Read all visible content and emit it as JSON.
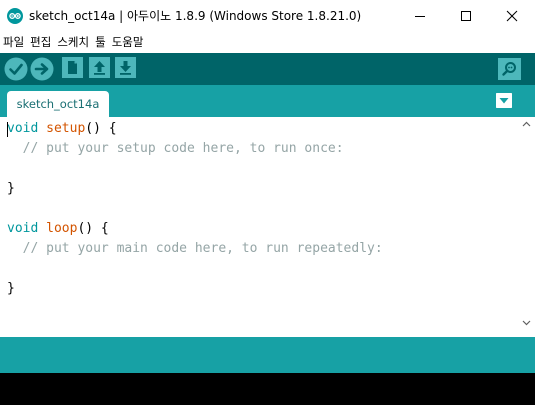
{
  "window": {
    "title": "sketch_oct14a | 아두이노 1.8.9 (Windows Store 1.8.21.0)"
  },
  "menu": {
    "items": [
      "파일",
      "편집",
      "스케치",
      "툴",
      "도움말"
    ]
  },
  "toolbar": {
    "buttons": [
      {
        "name": "verify",
        "icon": "check-icon"
      },
      {
        "name": "upload",
        "icon": "arrow-right-icon"
      },
      {
        "name": "new",
        "icon": "new-file-icon"
      },
      {
        "name": "open",
        "icon": "arrow-up-icon"
      },
      {
        "name": "save",
        "icon": "arrow-down-icon"
      },
      {
        "name": "serial-monitor",
        "icon": "magnifier-icon"
      }
    ]
  },
  "tabs": {
    "active": "sketch_oct14a"
  },
  "editor": {
    "lines": [
      {
        "kw": "void",
        "fn": "setup",
        "rest": "() {"
      },
      {
        "comment": "  // put your setup code here, to run once:"
      },
      {
        "plain": ""
      },
      {
        "plain": "}"
      },
      {
        "plain": ""
      },
      {
        "kw": "void",
        "fn": "loop",
        "rest": "() {"
      },
      {
        "comment": "  // put your main code here, to run repeatedly:"
      },
      {
        "plain": ""
      },
      {
        "plain": "}"
      }
    ]
  },
  "colors": {
    "toolbar": "#006468",
    "tabbar": "#17a1a5",
    "keyword": "#00979d",
    "function": "#d35400",
    "comment": "#95a5a6"
  }
}
